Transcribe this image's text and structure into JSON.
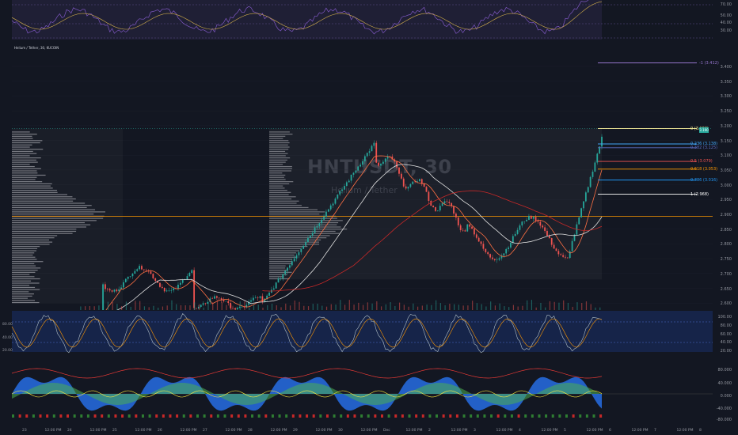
{
  "chart_title": "Helium / Tether, 30, KUCOIN",
  "watermark": {
    "symbol": "HNTUSDT, 30",
    "name": "Helium / Tether"
  },
  "colors": {
    "background": "#131722",
    "grid": "#1e222d",
    "rsi_band": "#7e57c2",
    "stoch_band": "#2962ff",
    "fib0": "#fff59d",
    "fib0236": "#42a5f5",
    "fib0382": "#5c6bc0",
    "fib05": "#ef5350",
    "fib0618": "#ff9800",
    "fib0786": "#2196f3",
    "fib1": "#ffffff",
    "fib_neg1": "#9575cd",
    "poc": "#ff9800"
  },
  "top_rsi_axis": [
    "70.00",
    "50.00",
    "40.00",
    "30.00"
  ],
  "price_axis": [
    "3.400",
    "3.350",
    "3.300",
    "3.250",
    "3.200",
    "3.150",
    "3.100",
    "3.050",
    "3.000",
    "2.950",
    "2.900",
    "2.850",
    "2.800",
    "2.750",
    "2.700",
    "2.650",
    "2.600"
  ],
  "fib_levels": [
    {
      "label": "-1 (3.412)"
    },
    {
      "label": "0 (3.190)"
    },
    {
      "label": "0.236 (3.138)"
    },
    {
      "label": "0.382 (3.125)"
    },
    {
      "label": "0.5 (3.079)"
    },
    {
      "label": "0.618 (3.053)"
    },
    {
      "label": "0.786 (3.016)"
    },
    {
      "label": "1 (2.968)"
    }
  ],
  "last_price_badge": "3.190",
  "stoch_axis": [
    "100.00",
    "80.00",
    "60.00",
    "40.00",
    "20.00"
  ],
  "stoch_left_axis": [
    "80.00",
    "40.00",
    "20.00"
  ],
  "osc_axis": [
    "80.000",
    "40.000",
    "0.000",
    "-40.000",
    "-80.000"
  ],
  "time_axis": [
    "23",
    "12:00 PM",
    "24",
    "12:00 PM",
    "25",
    "12:00 PM",
    "26",
    "12:00 PM",
    "27",
    "12:00 PM",
    "28",
    "12:00 PM",
    "29",
    "12:00 PM",
    "30",
    "12:00 PM",
    "Dec",
    "12:00 PM",
    "2",
    "12:00 PM",
    "3",
    "12:00 PM",
    "4",
    "12:00 PM",
    "5",
    "12:00 PM",
    "6",
    "12:00 PM",
    "7",
    "12:00 PM",
    "8"
  ]
}
